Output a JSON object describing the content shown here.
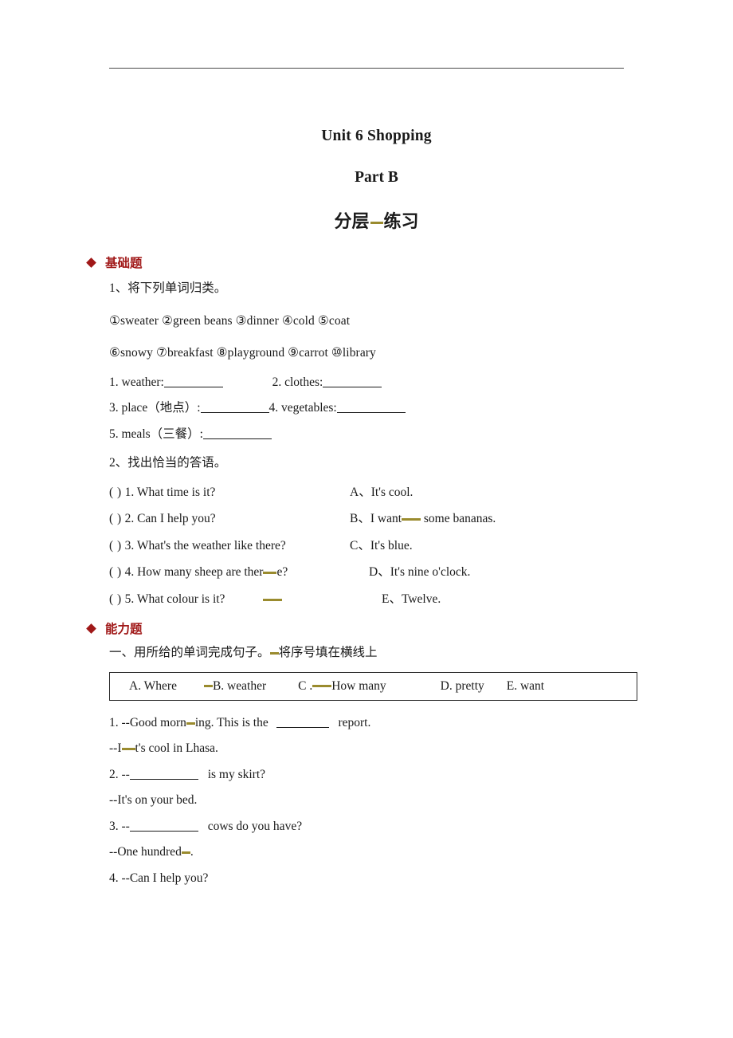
{
  "document": {
    "title": "Unit 6 Shopping",
    "subtitle": "Part B",
    "heading_cn_left": "分层",
    "heading_cn_right": "练习"
  },
  "sections": [
    {
      "id": "basic",
      "header": "基础题",
      "exercise1": {
        "instruction": "1、将下列单词归类。",
        "word_line_1": "①sweater ②green beans ③dinner ④cold ⑤coat",
        "word_line_2": "⑥snowy ⑦breakfast ⑧playground ⑨carrot ⑩library",
        "categories": [
          {
            "num": "1.",
            "label": "weather:"
          },
          {
            "num": "2.",
            "label": "clothes:"
          },
          {
            "num": "3.",
            "label": "place（地点）:"
          },
          {
            "num": "4.",
            "label": "vegetables:"
          },
          {
            "num": "5.",
            "label": "meals（三餐）:"
          }
        ]
      },
      "exercise2": {
        "instruction": "2、找出恰当的答语。",
        "rows": [
          {
            "paren": "(    )",
            "q_num": "1.",
            "question": "What time is it?",
            "a_letter": "A、",
            "answer": "It's cool."
          },
          {
            "paren": "(    )",
            "q_num": "2.",
            "question": "Can I help you?",
            "a_letter": "B、",
            "answer_pre": "I want",
            "answer_post": "some bananas."
          },
          {
            "paren": "(    )",
            "q_num": "3.",
            "question": "What's the weather like there?",
            "a_letter": "C、",
            "answer": "It's blue."
          },
          {
            "paren": "(    )",
            "q_num": "4.",
            "question_pre": "How many sheep are ther",
            "question_post": "e?",
            "a_letter": "D、",
            "answer": "It's nine o'clock."
          },
          {
            "paren": "(    )",
            "q_num": "5.",
            "question": "What colour is it?",
            "a_letter": "E、",
            "answer": "Twelve."
          }
        ]
      }
    },
    {
      "id": "ability",
      "header": "能力题",
      "instruction_pre": "一、用所给的单词完成句子。",
      "instruction_post": "将序号填在横线上",
      "wordbank": [
        {
          "label": "A. Where"
        },
        {
          "label": "B. weather"
        },
        {
          "label": "C ."
        },
        {
          "label": "How many"
        },
        {
          "label": "D. pretty"
        },
        {
          "label": "E. want"
        }
      ],
      "questions": [
        {
          "num": "1.",
          "pre": "--Good morn",
          "post": "ing. This is the",
          "tail": "report."
        },
        {
          "answer_pre": "--I",
          "answer_post": "t's cool in Lhasa."
        },
        {
          "num": "2.",
          "pre": "--",
          "tail": "is my skirt?"
        },
        {
          "answer": "--It's on your bed."
        },
        {
          "num": "3.",
          "pre": "--",
          "tail": "cows do you have?"
        },
        {
          "answer_pre": "--One hundred",
          "answer_post": "."
        },
        {
          "num": "4.",
          "text": "--Can I help you?"
        }
      ]
    }
  ],
  "colors": {
    "section_red": "#a01818",
    "annotation_olive": "#9a8b2e",
    "rule_gray": "#4a4a4a",
    "text": "#1a1a1a"
  }
}
